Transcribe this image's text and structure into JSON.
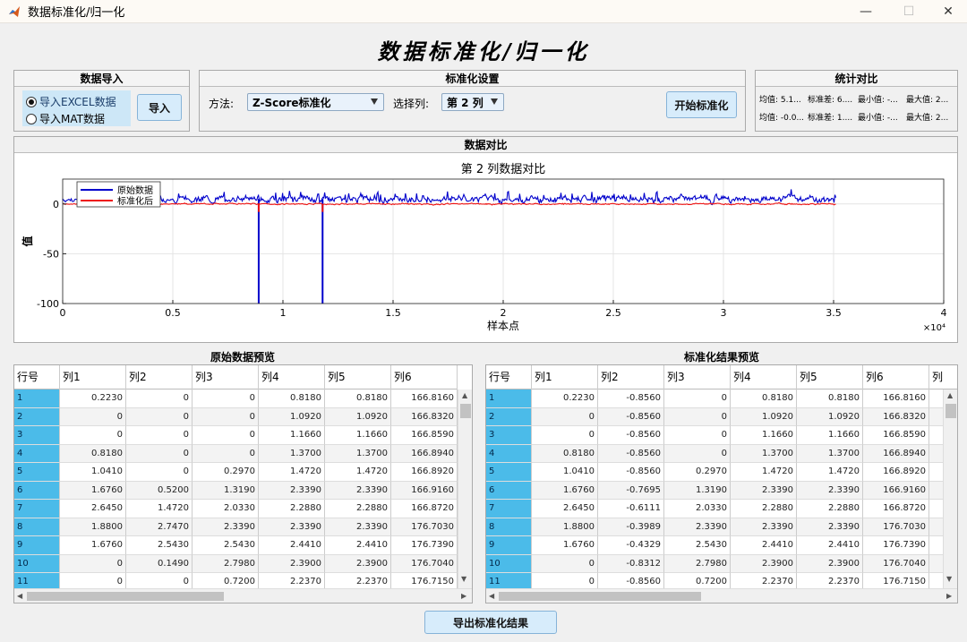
{
  "window": {
    "title": "数据标准化/归一化"
  },
  "main_title": "数据标准化/归一化",
  "import_panel": {
    "title": "数据导入",
    "options": [
      "导入EXCEL数据",
      "导入MAT数据"
    ],
    "selected": 0,
    "import_button": "导入"
  },
  "settings_panel": {
    "title": "标准化设置",
    "method_label": "方法:",
    "method_value": "Z-Score标准化",
    "column_label": "选择列:",
    "column_value": "第 2 列",
    "start_button": "开始标准化"
  },
  "stats_panel": {
    "title": "统计对比",
    "rows": [
      [
        "均值: 5.1...",
        "标准差: 6....",
        "最小值: -...",
        "最大值: 2..."
      ],
      [
        "均值: -0.0...",
        "标准差: 1....",
        "最小值: -...",
        "最大值: 2..."
      ]
    ]
  },
  "compare_panel": {
    "title": "数据对比"
  },
  "chart_data": {
    "type": "line",
    "title": "第 2 列数据对比",
    "xlabel": "样本点",
    "ylabel": "值",
    "xlim": [
      0,
      40000
    ],
    "ylim": [
      -100,
      25
    ],
    "x_ticks": [
      "0",
      "0.5",
      "1",
      "1.5",
      "2",
      "2.5",
      "3",
      "3.5",
      "4"
    ],
    "x_exponent": "×10⁴",
    "y_ticks": [
      "0",
      "-50",
      "-100"
    ],
    "grid": true,
    "legend_position": "top-left",
    "n_samples": 35100,
    "series": [
      {
        "name": "原始数据",
        "color": "#0000cc",
        "baseline": 5,
        "noise": 3,
        "dips": [
          [
            8900,
            -100
          ],
          [
            11800,
            -100
          ]
        ]
      },
      {
        "name": "标准化后",
        "color": "#ee1111",
        "baseline": 0,
        "noise": 0.6,
        "dips": [
          [
            8900,
            -8
          ],
          [
            11800,
            -8
          ]
        ]
      }
    ]
  },
  "left_table": {
    "title": "原始数据预览",
    "headers": [
      "行号",
      "列1",
      "列2",
      "列3",
      "列4",
      "列5",
      "列6"
    ],
    "rows": [
      [
        "1",
        "0.2230",
        "0",
        "0",
        "0.8180",
        "0.8180",
        "166.8160"
      ],
      [
        "2",
        "0",
        "0",
        "0",
        "1.0920",
        "1.0920",
        "166.8320"
      ],
      [
        "3",
        "0",
        "0",
        "0",
        "1.1660",
        "1.1660",
        "166.8590"
      ],
      [
        "4",
        "0.8180",
        "0",
        "0",
        "1.3700",
        "1.3700",
        "166.8940"
      ],
      [
        "5",
        "1.0410",
        "0",
        "0.2970",
        "1.4720",
        "1.4720",
        "166.8920"
      ],
      [
        "6",
        "1.6760",
        "0.5200",
        "1.3190",
        "2.3390",
        "2.3390",
        "166.9160"
      ],
      [
        "7",
        "2.6450",
        "1.4720",
        "2.0330",
        "2.2880",
        "2.2880",
        "166.8720"
      ],
      [
        "8",
        "1.8800",
        "2.7470",
        "2.3390",
        "2.3390",
        "2.3390",
        "176.7030"
      ],
      [
        "9",
        "1.6760",
        "2.5430",
        "2.5430",
        "2.4410",
        "2.4410",
        "176.7390"
      ],
      [
        "10",
        "0",
        "0.1490",
        "2.7980",
        "2.3900",
        "2.3900",
        "176.7040"
      ],
      [
        "11",
        "0",
        "0",
        "0.7200",
        "2.2370",
        "2.2370",
        "176.7150"
      ]
    ]
  },
  "right_table": {
    "title": "标准化结果预览",
    "headers": [
      "行号",
      "列1",
      "列2",
      "列3",
      "列4",
      "列5",
      "列6",
      "列"
    ],
    "rows": [
      [
        "1",
        "0.2230",
        "-0.8560",
        "0",
        "0.8180",
        "0.8180",
        "166.8160"
      ],
      [
        "2",
        "0",
        "-0.8560",
        "0",
        "1.0920",
        "1.0920",
        "166.8320"
      ],
      [
        "3",
        "0",
        "-0.8560",
        "0",
        "1.1660",
        "1.1660",
        "166.8590"
      ],
      [
        "4",
        "0.8180",
        "-0.8560",
        "0",
        "1.3700",
        "1.3700",
        "166.8940"
      ],
      [
        "5",
        "1.0410",
        "-0.8560",
        "0.2970",
        "1.4720",
        "1.4720",
        "166.8920"
      ],
      [
        "6",
        "1.6760",
        "-0.7695",
        "1.3190",
        "2.3390",
        "2.3390",
        "166.9160"
      ],
      [
        "7",
        "2.6450",
        "-0.6111",
        "2.0330",
        "2.2880",
        "2.2880",
        "166.8720"
      ],
      [
        "8",
        "1.8800",
        "-0.3989",
        "2.3390",
        "2.3390",
        "2.3390",
        "176.7030"
      ],
      [
        "9",
        "1.6760",
        "-0.4329",
        "2.5430",
        "2.4410",
        "2.4410",
        "176.7390"
      ],
      [
        "10",
        "0",
        "-0.8312",
        "2.7980",
        "2.3900",
        "2.3900",
        "176.7040"
      ],
      [
        "11",
        "0",
        "-0.8560",
        "0.7200",
        "2.2370",
        "2.2370",
        "176.7150"
      ]
    ]
  },
  "export_button": "导出标准化结果"
}
